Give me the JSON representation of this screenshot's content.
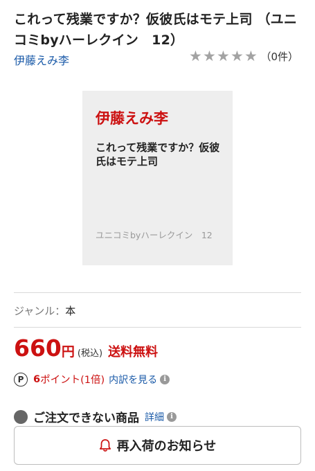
{
  "product": {
    "title": "これって残業ですか？仮彼氏はモテ上司 （ユニコミbyハーレクイン　12）",
    "author": "伊藤えみ李",
    "rating_count": "（0件）",
    "stars": 0
  },
  "cover": {
    "author": "伊藤えみ李",
    "title": "これって残業ですか？仮彼氏はモテ上司",
    "series": "ユニコミbyハーレクイン　12"
  },
  "genre": {
    "label": "ジャンル：",
    "value": "本"
  },
  "price": {
    "amount": "660",
    "unit": "円",
    "tax": "(税込)",
    "shipping": "送料無料"
  },
  "points": {
    "icon": "P",
    "amount": "6",
    "text": "ポイント(1倍)",
    "breakdown_link": "内訳を見る"
  },
  "availability": {
    "status": "ご注文できない商品",
    "detail_link": "詳細"
  },
  "notify_button": {
    "label": "再入荷のお知らせ"
  },
  "colors": {
    "accent_red": "#cc1111",
    "link_blue": "#1a5aa8",
    "star_gray": "#a3a3a3"
  }
}
